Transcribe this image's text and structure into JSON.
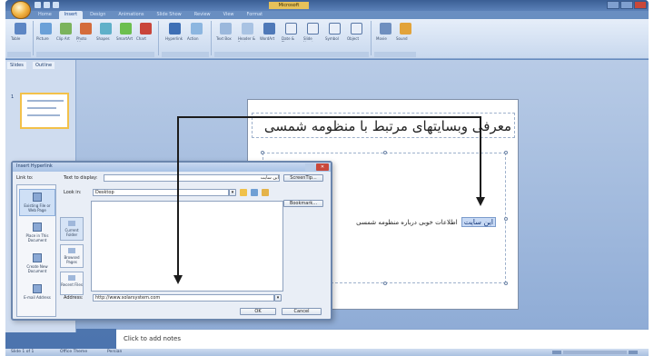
{
  "window": {
    "title": "Microsoft PowerPoint"
  },
  "tabs": [
    "Home",
    "Insert",
    "Design",
    "Animations",
    "Slide Show",
    "Review",
    "View",
    "Format"
  ],
  "ribbon": {
    "buttons": [
      "Table",
      "Picture",
      "Clip Art",
      "Photo Album",
      "Shapes",
      "SmartArt",
      "Chart",
      "Hyperlink",
      "Action",
      "Text Box",
      "Header & Footer",
      "WordArt",
      "Date & Time",
      "Slide Number",
      "Symbol",
      "Object",
      "Movie",
      "Sound"
    ],
    "groups": [
      "Tables",
      "Illustrations",
      "Links",
      "Text",
      "Media Clips"
    ]
  },
  "left_pane": {
    "tabs": [
      "Slides",
      "Outline"
    ],
    "slide_number": "1"
  },
  "slide": {
    "title": "معرفی وبسایتهای مرتبط با منظومه شمسی",
    "link_text": "این سایت",
    "body_text": "اطلاعات خوبی درباره منظومه شمسی"
  },
  "notes": {
    "placeholder": "Click to add notes"
  },
  "status": {
    "slide_info": "Slide 1 of 1",
    "theme": "Office Theme",
    "language": "Persian"
  },
  "dialog": {
    "title": "Insert Hyperlink",
    "link_to_label": "Link to:",
    "text_to_display_label": "Text to display:",
    "text_to_display_value": "این سایت",
    "screentip_button": "ScreenTip...",
    "look_in_label": "Look in:",
    "look_in_value": "Desktop",
    "bookmark_button": "Bookmark...",
    "address_label": "Address:",
    "address_value": "http://www.solarsystem.com",
    "ok_button": "OK",
    "cancel_button": "Cancel",
    "link_options": [
      "Existing File or Web Page",
      "Place in This Document",
      "Create New Document",
      "E-mail Address"
    ],
    "browse_options": [
      "Current Folder",
      "Browsed Pages",
      "Recent Files"
    ]
  },
  "colors": {
    "ribbon": "#dfe9f7",
    "accent": "#f3c14a",
    "close": "#c9483a"
  }
}
